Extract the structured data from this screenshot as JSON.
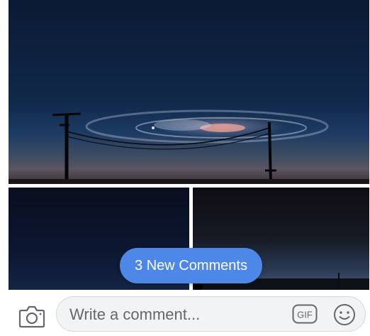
{
  "new_comments": {
    "label": "3 New Comments"
  },
  "composer": {
    "placeholder": "Write a comment...",
    "value": "",
    "gif_label": "GIF",
    "camera_icon": "camera-icon",
    "emoji_icon": "smiley-icon"
  },
  "colors": {
    "accent": "#4d87e8",
    "input_bg": "#f2f3f5",
    "icon_gray": "#65676b"
  }
}
